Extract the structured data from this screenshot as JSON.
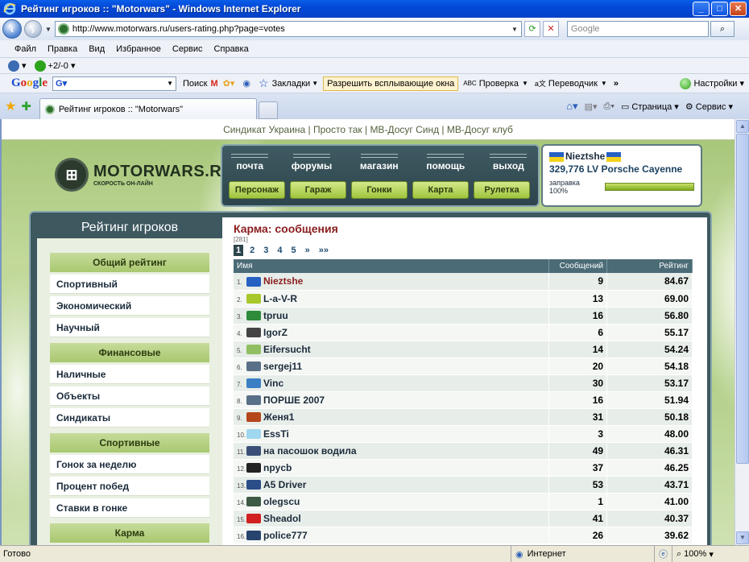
{
  "window": {
    "title": "Рейтинг игроков :: \"Motorwars\" - Windows Internet Explorer",
    "minimize": "_",
    "maximize": "□",
    "close": "✕"
  },
  "address": {
    "url": "http://www.motorwars.ru/users-rating.php?page=votes",
    "search_placeholder": "Google"
  },
  "menu": [
    "Файл",
    "Правка",
    "Вид",
    "Избранное",
    "Сервис",
    "Справка"
  ],
  "links_bar": {
    "counter": "+2/-0"
  },
  "google_bar": {
    "logo": [
      "G",
      "o",
      "o",
      "g",
      "l",
      "e"
    ],
    "search_label": "Поиск",
    "bookmarks": "Закладки",
    "popups": "Разрешить всплывающие окна",
    "spellcheck": "Проверка",
    "translate": "Переводчик",
    "more": "»",
    "settings": "Настройки"
  },
  "tabs": {
    "active_tab": "Рейтинг игроков :: \"Motorwars\"",
    "page": "Страница",
    "service": "Сервис"
  },
  "site": {
    "toplinks": [
      "Синдикат Украина",
      "Просто так",
      "МВ-Досуг Синд",
      "МВ-Досуг клуб"
    ],
    "logo_name": "MOTORWARS.RU",
    "logo_tag": "СКОРОСТЬ ОН-ЛАЙН",
    "nav_top": [
      "почта",
      "форумы",
      "магазин",
      "помощь",
      "выход"
    ],
    "nav_bottom": [
      "Персонаж",
      "Гараж",
      "Гонки",
      "Карта",
      "Рулетка"
    ],
    "user": {
      "nick": "Nieztshe",
      "car": "329,776 LV Porsche Cayenne",
      "fuel_label": "заправка 100%",
      "fuel_percent": 100
    },
    "left_title": "Рейтинг игроков",
    "sections": [
      {
        "head": "Общий рейтинг",
        "items": [
          "Спортивный",
          "Экономический",
          "Научный"
        ]
      },
      {
        "head": "Финансовые",
        "items": [
          "Наличные",
          "Объекты",
          "Синдикаты"
        ]
      },
      {
        "head": "Спортивные",
        "items": [
          "Гонок за неделю",
          "Процент побед",
          "Ставки в гонке"
        ]
      },
      {
        "head": "Карма",
        "items": []
      }
    ],
    "rating": {
      "title": "Карма: сообщения",
      "count": "[281]",
      "pages": [
        "1",
        "2",
        "3",
        "4",
        "5",
        "»",
        "»»"
      ],
      "columns": [
        "Имя",
        "Сообщений",
        "Рейтинг"
      ],
      "rows": [
        {
          "rank": "1.",
          "name": "Nieztshe",
          "messages": "9",
          "rating": "84.67",
          "avatar": "ukraine-flag",
          "color": "#2660c2"
        },
        {
          "rank": "2.",
          "name": "L-a-V-R",
          "messages": "13",
          "rating": "69.00",
          "avatar": "bulb-icon",
          "color": "#a8c72b"
        },
        {
          "rank": "3.",
          "name": "tpruu",
          "messages": "16",
          "rating": "56.80",
          "avatar": "dollar-icon",
          "color": "#2e8b3a"
        },
        {
          "rank": "4.",
          "name": "IgorZ",
          "messages": "6",
          "rating": "55.17",
          "avatar": "gun-icon",
          "color": "#444444"
        },
        {
          "rank": "5.",
          "name": "Eifersucht",
          "messages": "14",
          "rating": "54.24",
          "avatar": "money-icon",
          "color": "#8fbf62"
        },
        {
          "rank": "6.",
          "name": "sergej11",
          "messages": "20",
          "rating": "54.18",
          "avatar": "syndicate-badge",
          "color": "#5a6f88"
        },
        {
          "rank": "7.",
          "name": "Vinc",
          "messages": "30",
          "rating": "53.17",
          "avatar": "eye-icon",
          "color": "#3b7fc4"
        },
        {
          "rank": "8.",
          "name": "ПОРШЕ 2007",
          "messages": "16",
          "rating": "51.94",
          "avatar": "syndicate-badge",
          "color": "#5a6f88"
        },
        {
          "rank": "9.",
          "name": "Женя1",
          "messages": "31",
          "rating": "50.18",
          "avatar": "smiley-icon",
          "color": "#b5461c"
        },
        {
          "rank": "10.",
          "name": "EssTi",
          "messages": "3",
          "rating": "48.00",
          "avatar": "drop-icon",
          "color": "#9fd8ef"
        },
        {
          "rank": "11.",
          "name": "на пасошок водила",
          "messages": "49",
          "rating": "46.31",
          "avatar": "car-icon",
          "color": "#3a4f77"
        },
        {
          "rank": "12.",
          "name": "npycb",
          "messages": "37",
          "rating": "46.25",
          "avatar": "paw-icon",
          "color": "#222222"
        },
        {
          "rank": "13.",
          "name": "A5 Driver",
          "messages": "53",
          "rating": "43.71",
          "avatar": "car-icon",
          "color": "#2b4d88"
        },
        {
          "rank": "14.",
          "name": "olegscu",
          "messages": "1",
          "rating": "41.00",
          "avatar": "car-icon",
          "color": "#3d5a44"
        },
        {
          "rank": "15.",
          "name": "Sheadol",
          "messages": "41",
          "rating": "40.37",
          "avatar": "lukoil-icon",
          "color": "#d21f1f"
        },
        {
          "rank": "16.",
          "name": "police777",
          "messages": "26",
          "rating": "39.62",
          "avatar": "police-icon",
          "color": "#27446e"
        }
      ]
    }
  },
  "status": {
    "ready": "Готово",
    "zone": "Интернет",
    "zoom": "100%"
  }
}
